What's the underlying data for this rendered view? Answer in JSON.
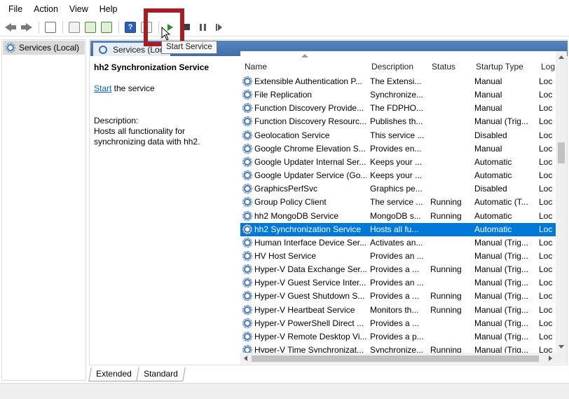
{
  "menu": [
    "File",
    "Action",
    "View",
    "Help"
  ],
  "tooltip": "Start Service",
  "tree": {
    "root_label": "Services (Local)"
  },
  "header": {
    "tab_label": "Services (Loc"
  },
  "description_pane": {
    "title": "hh2 Synchronization Service",
    "start_link": "Start",
    "start_suffix": " the service",
    "description_label": "Description:",
    "description_text": "Hosts all functionality for synchronizing data with hh2."
  },
  "columns": {
    "name": "Name",
    "description": "Description",
    "status": "Status",
    "startup": "Startup Type",
    "log": "Log"
  },
  "rows": [
    {
      "name": "Extensible Authentication P...",
      "description": "The Extensi...",
      "status": "",
      "startup": "Manual",
      "log": "Loc"
    },
    {
      "name": "File Replication",
      "description": "Synchronize...",
      "status": "",
      "startup": "Manual",
      "log": "Loc"
    },
    {
      "name": "Function Discovery Provide...",
      "description": "The FDPHO...",
      "status": "",
      "startup": "Manual",
      "log": "Loc"
    },
    {
      "name": "Function Discovery Resourc...",
      "description": "Publishes th...",
      "status": "",
      "startup": "Manual (Trig...",
      "log": "Loc"
    },
    {
      "name": "Geolocation Service",
      "description": "This service ...",
      "status": "",
      "startup": "Disabled",
      "log": "Loc"
    },
    {
      "name": "Google Chrome Elevation S...",
      "description": "Provides en...",
      "status": "",
      "startup": "Manual",
      "log": "Loc"
    },
    {
      "name": "Google Updater Internal Ser...",
      "description": "Keeps your ...",
      "status": "",
      "startup": "Automatic",
      "log": "Loc"
    },
    {
      "name": "Google Updater Service (Go...",
      "description": "Keeps your ...",
      "status": "",
      "startup": "Automatic",
      "log": "Loc"
    },
    {
      "name": "GraphicsPerfSvc",
      "description": "Graphics pe...",
      "status": "",
      "startup": "Disabled",
      "log": "Loc"
    },
    {
      "name": "Group Policy Client",
      "description": "The service ...",
      "status": "Running",
      "startup": "Automatic (T...",
      "log": "Loc"
    },
    {
      "name": "hh2 MongoDB Service",
      "description": "MongoDB s...",
      "status": "Running",
      "startup": "Automatic",
      "log": "Loc"
    },
    {
      "name": "hh2 Synchronization Service",
      "description": "Hosts all fu...",
      "status": "",
      "startup": "Automatic",
      "log": "Loc",
      "selected": true
    },
    {
      "name": "Human Interface Device Ser...",
      "description": "Activates an...",
      "status": "",
      "startup": "Manual (Trig...",
      "log": "Loc"
    },
    {
      "name": "HV Host Service",
      "description": "Provides an ...",
      "status": "",
      "startup": "Manual (Trig...",
      "log": "Loc"
    },
    {
      "name": "Hyper-V Data Exchange Ser...",
      "description": "Provides a ...",
      "status": "Running",
      "startup": "Manual (Trig...",
      "log": "Loc"
    },
    {
      "name": "Hyper-V Guest Service Inter...",
      "description": "Provides an ...",
      "status": "",
      "startup": "Manual (Trig...",
      "log": "Loc"
    },
    {
      "name": "Hyper-V Guest Shutdown S...",
      "description": "Provides a ...",
      "status": "Running",
      "startup": "Manual (Trig...",
      "log": "Loc"
    },
    {
      "name": "Hyper-V Heartbeat Service",
      "description": "Monitors th...",
      "status": "Running",
      "startup": "Manual (Trig...",
      "log": "Loc"
    },
    {
      "name": "Hyper-V PowerShell Direct ...",
      "description": "Provides a ...",
      "status": "",
      "startup": "Manual (Trig...",
      "log": "Loc"
    },
    {
      "name": "Hyper-V Remote Desktop Vi...",
      "description": "Provides a p...",
      "status": "",
      "startup": "Manual (Trig...",
      "log": "Loc"
    },
    {
      "name": "Hyper-V Time Synchronizat...",
      "description": "Synchronize...",
      "status": "Running",
      "startup": "Manual (Trig...",
      "log": "Loc"
    }
  ],
  "tabs": [
    "Extended",
    "Standard"
  ]
}
